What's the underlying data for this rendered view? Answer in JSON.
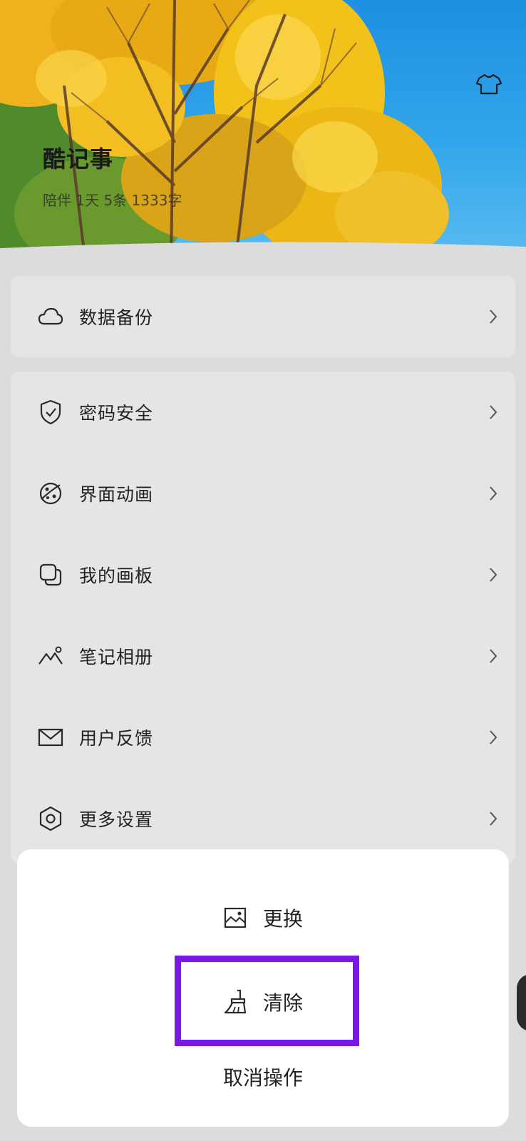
{
  "header": {
    "app_name": "酷记事",
    "stats": "陪伴 1天 5条 1333字",
    "theme_icon": "tshirt-icon"
  },
  "backup": {
    "label": "数据备份",
    "icon": "cloud-icon"
  },
  "menu": [
    {
      "label": "密码安全",
      "icon": "shield-check-icon"
    },
    {
      "label": "界面动画",
      "icon": "palette-icon"
    },
    {
      "label": "我的画板",
      "icon": "layers-icon"
    },
    {
      "label": "笔记相册",
      "icon": "mountain-icon"
    },
    {
      "label": "用户反馈",
      "icon": "mail-icon"
    },
    {
      "label": "更多设置",
      "icon": "hexagon-settings-icon"
    }
  ],
  "sheet": {
    "replace_label": "更换",
    "replace_icon": "image-icon",
    "clear_label": "清除",
    "clear_icon": "broom-icon",
    "cancel_label": "取消操作"
  },
  "colors": {
    "highlight": "#7a18e6",
    "card_bg": "#e5e5e5",
    "page_bg": "#dcdcdc"
  }
}
